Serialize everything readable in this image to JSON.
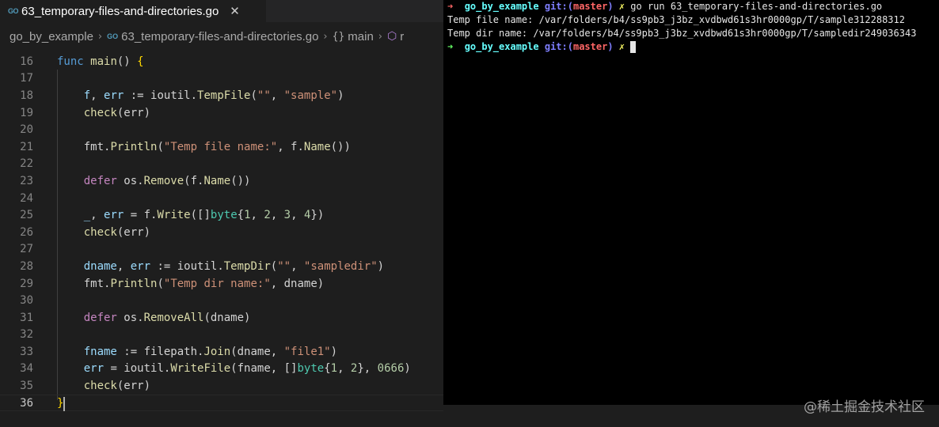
{
  "editor": {
    "tab": {
      "icon": "go-file-icon",
      "icon_text": "GO",
      "label": "63_temporary-files-and-directories.go",
      "close": "✕"
    },
    "breadcrumb": {
      "folder": "go_by_example",
      "file_icon_text": "GO",
      "file": "63_temporary-files-and-directories.go",
      "braces": "{}",
      "symbol": "main",
      "cube_icon": "⬡",
      "trail": "r"
    },
    "lines": [
      {
        "n": "16",
        "active": false
      },
      {
        "n": "17"
      },
      {
        "n": "18"
      },
      {
        "n": "19"
      },
      {
        "n": "20"
      },
      {
        "n": "21"
      },
      {
        "n": "22"
      },
      {
        "n": "23"
      },
      {
        "n": "24"
      },
      {
        "n": "25"
      },
      {
        "n": "26"
      },
      {
        "n": "27"
      },
      {
        "n": "28"
      },
      {
        "n": "29"
      },
      {
        "n": "30"
      },
      {
        "n": "31"
      },
      {
        "n": "32"
      },
      {
        "n": "33"
      },
      {
        "n": "34"
      },
      {
        "n": "35"
      },
      {
        "n": "36"
      }
    ],
    "code": {
      "l16": {
        "kw": "func",
        "fn": "main",
        "rest": "() ",
        "brace": "{"
      },
      "l18": {
        "a": "f",
        "b": ", ",
        "c": "err",
        "d": " := ioutil.",
        "e": "TempFile",
        "f": "(",
        "g": "\"\"",
        "h": ", ",
        "i": "\"sample\"",
        "j": ")"
      },
      "l19": {
        "a": "check",
        "b": "(err)"
      },
      "l21": {
        "a": "fmt.",
        "b": "Println",
        "c": "(",
        "d": "\"Temp file name:\"",
        "e": ", f.",
        "f": "Name",
        "g": "())"
      },
      "l23": {
        "a": "defer",
        "b": " os.",
        "c": "Remove",
        "d": "(f.",
        "e": "Name",
        "f": "())"
      },
      "l25": {
        "a": "_",
        "b": ", ",
        "c": "err",
        "d": " = f.",
        "e": "Write",
        "f": "([]",
        "g": "byte",
        "h": "{",
        "i": "1",
        "j": ", ",
        "k": "2",
        "l": ", ",
        "m": "3",
        "n": ", ",
        "o": "4",
        "p": "})"
      },
      "l26": {
        "a": "check",
        "b": "(err)"
      },
      "l28": {
        "a": "dname",
        "b": ", ",
        "c": "err",
        "d": " := ioutil.",
        "e": "TempDir",
        "f": "(",
        "g": "\"\"",
        "h": ", ",
        "i": "\"sampledir\"",
        "j": ")"
      },
      "l29": {
        "a": "fmt.",
        "b": "Println",
        "c": "(",
        "d": "\"Temp dir name:\"",
        "e": ", dname)"
      },
      "l31": {
        "a": "defer",
        "b": " os.",
        "c": "RemoveAll",
        "d": "(dname)"
      },
      "l33": {
        "a": "fname",
        "b": " := filepath.",
        "c": "Join",
        "d": "(dname, ",
        "e": "\"file1\"",
        "f": ")"
      },
      "l34": {
        "a": "err",
        "b": " = ioutil.",
        "c": "WriteFile",
        "d": "(fname, []",
        "e": "byte",
        "f": "{",
        "g": "1",
        "h": ", ",
        "i": "2",
        "j": "}, ",
        "k": "0666",
        "l": ")"
      },
      "l35": {
        "a": "check",
        "b": "(err)"
      },
      "l36": {
        "brace": "}"
      }
    }
  },
  "terminal": {
    "prompt_arrow": "➜",
    "dir": "go_by_example",
    "git": "git:(",
    "branch": "master",
    "git_close": ")",
    "dirty": "✗",
    "command": "go run 63_temporary-files-and-directories.go",
    "output": [
      "Temp file name: /var/folders/b4/ss9pb3_j3bz_xvdbwd61s3hr0000gp/T/sample312288312",
      "Temp dir name: /var/folders/b4/ss9pb3_j3bz_xvdbwd61s3hr0000gp/T/sampledir249036343"
    ]
  },
  "watermark": "@稀土掘金技术社区"
}
